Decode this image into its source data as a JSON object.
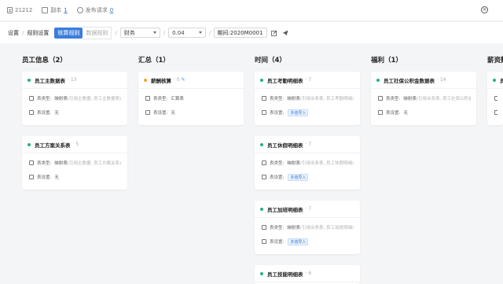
{
  "topbar": {
    "id_text": "21212",
    "copies_label": "副本",
    "copies_count": "1",
    "pending_label": "发布请求",
    "pending_count": "0",
    "close_glyph": "✕"
  },
  "filterbar": {
    "crumb_settings": "设置",
    "crumb_rules": "规则设置",
    "seg_active": "核算规则",
    "seg_inactive": "数据规则",
    "select_unit": "财务",
    "select_version": "0.04",
    "period_text": "期间:2020M0001"
  },
  "columns": [
    {
      "title": "员工信息（2）"
    },
    {
      "title": "汇总（1）"
    },
    {
      "title": "时间（4）"
    },
    {
      "title": "福利（1）"
    },
    {
      "title": "薪资数"
    }
  ],
  "cards": [
    {
      "name": "员工主数据表",
      "sub": "· 13",
      "type_label": "表类型:",
      "type_val": "映射表",
      "type_muted": "(引用主数据, 员工主数据表)",
      "set_label": "表设置:",
      "set_val": "无",
      "set_tag": ""
    },
    {
      "name": "员工方案关系表",
      "sub": "· 5",
      "type_label": "表类型:",
      "type_val": "映射表",
      "type_muted": "(引用主数据, 员工方案关系)",
      "set_label": "表设置:",
      "set_val": "无",
      "set_tag": ""
    },
    {
      "name": "薪酬核算",
      "sub": "· 0",
      "type_label": "表类型:",
      "type_val": "汇算表",
      "type_muted": "",
      "set_label": "表设置:",
      "set_val": "无",
      "set_tag": ""
    },
    {
      "name": "员工考勤明细表",
      "sub": "· 7",
      "type_label": "表类型:",
      "type_val": "映射表",
      "type_muted": "(引用业务表, 员工考勤明细)",
      "set_label": "表设置:",
      "set_val": "",
      "set_tag": "多值导入"
    },
    {
      "name": "员工休假明细表",
      "sub": "· 7",
      "type_label": "表类型:",
      "type_val": "映射表",
      "type_muted": "(引用业务表, 员工休假明细)",
      "set_label": "表设置:",
      "set_val": "",
      "set_tag": "多值导入"
    },
    {
      "name": "员工加班明细表",
      "sub": "· 7",
      "type_label": "表类型:",
      "type_val": "映射表",
      "type_muted": "(引用业务表, 员工加班明细)",
      "set_label": "表设置:",
      "set_val": "",
      "set_tag": "多值导入"
    },
    {
      "name": "员工技能明细表",
      "sub": "· 6",
      "type_label": "",
      "type_val": "",
      "type_muted": "",
      "set_label": "",
      "set_val": "",
      "set_tag": ""
    },
    {
      "name": "员工社保公积金数据表",
      "sub": "· 14",
      "type_label": "表类型:",
      "type_val": "映射表",
      "type_muted": "(引用业务表, 员工社保公积金)",
      "set_label": "表设置:",
      "set_val": "无",
      "set_tag": ""
    },
    {
      "name": "员",
      "sub": "",
      "type_label": "表",
      "type_val": "",
      "type_muted": "",
      "set_label": "表",
      "set_val": "",
      "set_tag": ""
    }
  ],
  "icons": {
    "doc": "doc-icon",
    "copy": "copy-icon",
    "share": "share-icon",
    "edit": "edit-icon",
    "send": "send-icon",
    "type": "table-type-icon",
    "settings": "table-settings-icon",
    "pin": "pin-icon"
  },
  "colors": {
    "accent": "#3b7ddd",
    "status_green": "#1fb57a",
    "status_orange": "#f5a623",
    "background": "#f4f5f7"
  }
}
